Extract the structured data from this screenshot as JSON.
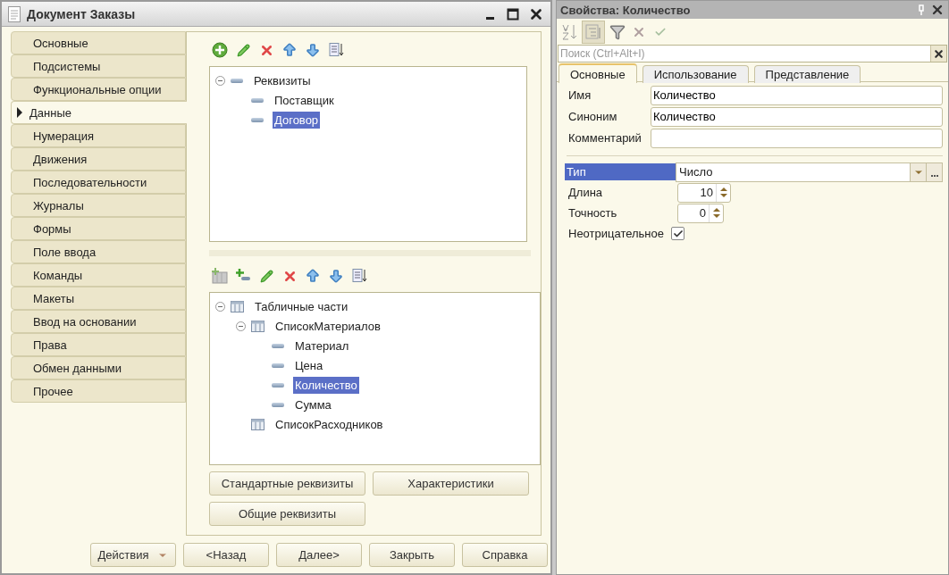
{
  "main_window": {
    "title": "Документ Заказы",
    "sections": [
      {
        "label": "Основные",
        "selected": false
      },
      {
        "label": "Подсистемы",
        "selected": false
      },
      {
        "label": "Функциональные опции",
        "selected": false
      },
      {
        "label": "Данные",
        "selected": true
      },
      {
        "label": "Нумерация",
        "selected": false
      },
      {
        "label": "Движения",
        "selected": false
      },
      {
        "label": "Последовательности",
        "selected": false
      },
      {
        "label": "Журналы",
        "selected": false
      },
      {
        "label": "Формы",
        "selected": false
      },
      {
        "label": "Поле ввода",
        "selected": false
      },
      {
        "label": "Команды",
        "selected": false
      },
      {
        "label": "Макеты",
        "selected": false
      },
      {
        "label": "Ввод на основании",
        "selected": false
      },
      {
        "label": "Права",
        "selected": false
      },
      {
        "label": "Обмен данными",
        "selected": false
      },
      {
        "label": "Прочее",
        "selected": false
      }
    ],
    "attributes_tree": [
      {
        "label": "Реквизиты",
        "kind": "attribute",
        "expanded": true,
        "selected": false,
        "children": [
          {
            "label": "Поставщик",
            "kind": "attribute",
            "selected": false
          },
          {
            "label": "Договор",
            "kind": "attribute",
            "selected": true
          }
        ]
      }
    ],
    "tabular_tree": [
      {
        "label": "Табличные части",
        "kind": "table",
        "expanded": true,
        "selected": false,
        "children": [
          {
            "label": "СписокМатериалов",
            "kind": "table",
            "expanded": true,
            "selected": false,
            "children": [
              {
                "label": "Материал",
                "kind": "attribute",
                "selected": false
              },
              {
                "label": "Цена",
                "kind": "attribute",
                "selected": false
              },
              {
                "label": "Количество",
                "kind": "attribute",
                "selected": true
              },
              {
                "label": "Сумма",
                "kind": "attribute",
                "selected": false
              }
            ]
          },
          {
            "label": "СписокРасходников",
            "kind": "table",
            "selected": false
          }
        ]
      }
    ],
    "panel_buttons": [
      "Стандартные реквизиты",
      "Характеристики",
      "Общие реквизиты"
    ],
    "footer_buttons": [
      {
        "label": "Действия",
        "kind": "dropdown"
      },
      {
        "label": "<Назад",
        "kind": "plain"
      },
      {
        "label": "Далее>",
        "kind": "plain"
      },
      {
        "label": "Закрыть",
        "kind": "plain"
      },
      {
        "label": "Справка",
        "kind": "plain"
      }
    ]
  },
  "properties": {
    "title": "Свойства: Количество",
    "search": {
      "placeholder": "Поиск (Ctrl+Alt+I)"
    },
    "tabs": [
      {
        "label": "Основные",
        "selected": true
      },
      {
        "label": "Использование",
        "selected": false
      },
      {
        "label": "Представление",
        "selected": false
      }
    ],
    "fields": [
      {
        "kind": "text",
        "label": "Имя",
        "value": "Количество"
      },
      {
        "kind": "text",
        "label": "Синоним",
        "value": "Количество"
      },
      {
        "kind": "text",
        "label": "Комментарий"
      },
      {
        "kind": "separator"
      },
      {
        "kind": "select",
        "label": "Тип",
        "value": "Число",
        "selected": true
      },
      {
        "kind": "spin",
        "label": "Длина",
        "value": "10"
      },
      {
        "kind": "spin",
        "label": "Точность",
        "value": "0"
      },
      {
        "kind": "checkbox",
        "label": "Неотрицательное",
        "checked": true
      }
    ]
  }
}
